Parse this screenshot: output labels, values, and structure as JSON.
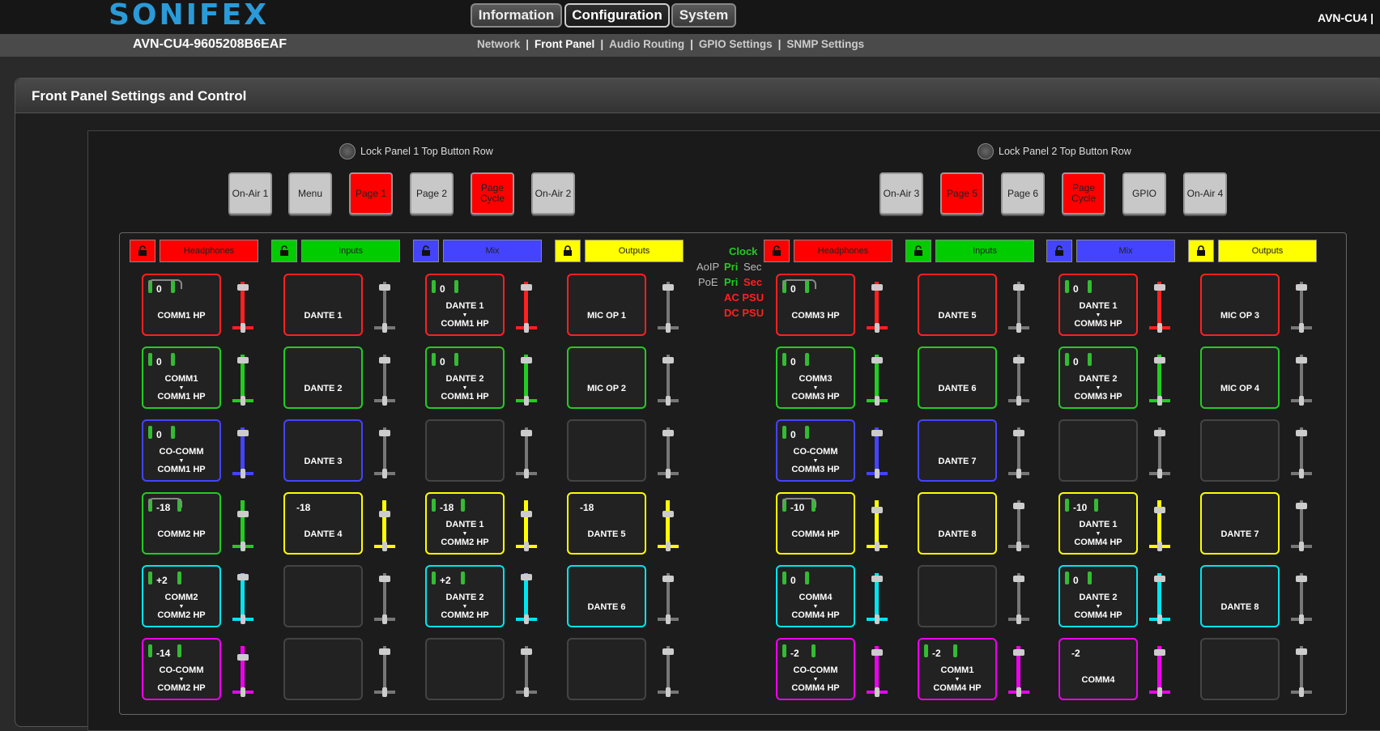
{
  "brand": {
    "name": "SONIFEX"
  },
  "nav": {
    "tabs": [
      {
        "label": "Information"
      },
      {
        "label": "Configuration"
      },
      {
        "label": "System"
      }
    ],
    "device": "AVN-CU4 |"
  },
  "subnav": {
    "device_id": "AVN-CU4-9605208B6EAF",
    "links": [
      "Network",
      "Front Panel",
      "Audio Routing",
      "GPIO Settings",
      "SNMP Settings"
    ]
  },
  "panel": {
    "title": "Front Panel Settings and Control"
  },
  "locks": {
    "panel1": "Lock Panel 1 Top Button Row",
    "panel2": "Lock Panel 2 Top Button Row"
  },
  "top_buttons": [
    {
      "label": "On-Air 1",
      "color": "grey"
    },
    {
      "label": "Menu",
      "color": "grey"
    },
    {
      "label": "Page 1",
      "color": "red"
    },
    {
      "label": "Page 2",
      "color": "grey"
    },
    {
      "label": "Page\nCycle",
      "color": "red"
    },
    {
      "label": "On-Air 2",
      "color": "grey"
    },
    {
      "label": "On-Air 3",
      "color": "grey"
    },
    {
      "label": "Page 5",
      "color": "red"
    },
    {
      "label": "Page 6",
      "color": "grey"
    },
    {
      "label": "Page\nCycle",
      "color": "red"
    },
    {
      "label": "GPIO",
      "color": "grey"
    },
    {
      "label": "On-Air 4",
      "color": "grey"
    }
  ],
  "headers": [
    {
      "label": "Headphones",
      "color": "#ff0000",
      "lock": "unlocked"
    },
    {
      "label": "Inputs",
      "color": "#00cc00",
      "lock": "unlocked"
    },
    {
      "label": "Mix",
      "color": "#4444ff",
      "lock": "unlocked"
    },
    {
      "label": "Outputs",
      "color": "#ffff00",
      "lock": "locked"
    },
    {
      "label": "Headphones",
      "color": "#ff0000",
      "lock": "unlocked"
    },
    {
      "label": "Inputs",
      "color": "#00cc00",
      "lock": "unlocked"
    },
    {
      "label": "Mix",
      "color": "#4444ff",
      "lock": "unlocked"
    },
    {
      "label": "Outputs",
      "color": "#ffff00",
      "lock": "locked"
    }
  ],
  "status": {
    "clock": "Clock",
    "aoip": "AoIP",
    "poe": "PoE",
    "pri": "Pri",
    "sec": "Sec",
    "ac_psu": "AC PSU",
    "dc_psu": "DC PSU"
  },
  "columns": [
    [
      {
        "c": "#ff2020",
        "lvl": "0",
        "l1": "",
        "l2": "COMM1 HP",
        "pills": true,
        "bracket": true,
        "fc": "#ff2020",
        "fp": 0.05
      },
      {
        "c": "#22cc22",
        "lvl": "0",
        "l1": "COMM1",
        "l2": "COMM1 HP",
        "pills": true,
        "fc": "#22cc22",
        "fp": 0.05
      },
      {
        "c": "#4444ff",
        "lvl": "0",
        "l1": "CO-COMM",
        "l2": "COMM1 HP",
        "pills": true,
        "fc": "#4444ff",
        "fp": 0.05
      },
      {
        "c": "#22cc22",
        "lvl": "-18",
        "l1": "",
        "l2": "COMM2 HP",
        "pills": true,
        "bracket": true,
        "fc": "#22cc22",
        "fp": 0.25
      },
      {
        "c": "#00e5ee",
        "lvl": "+2",
        "l1": "COMM2",
        "l2": "COMM2 HP",
        "pills": true,
        "fc": "#00e5ee",
        "fp": 0.02
      },
      {
        "c": "#ee00ee",
        "lvl": "-14",
        "l1": "CO-COMM",
        "l2": "COMM2 HP",
        "pills": true,
        "fc": "#ee00ee",
        "fp": 0.2
      }
    ],
    [
      {
        "c": "#ff2020",
        "lvl": "",
        "l1": "",
        "l2": "DANTE 1",
        "fc": "#777",
        "fp": 0.05
      },
      {
        "c": "#22cc22",
        "lvl": "",
        "l1": "",
        "l2": "DANTE 2",
        "fc": "#777",
        "fp": 0.05
      },
      {
        "c": "#4444ff",
        "lvl": "",
        "l1": "",
        "l2": "DANTE 3",
        "fc": "#777",
        "fp": 0.05
      },
      {
        "c": "#ffff00",
        "lvl": "-18",
        "l1": "",
        "l2": "DANTE 4",
        "fc": "#ffff00",
        "fp": 0.25
      },
      {
        "c": "#444444",
        "lvl": "",
        "l1": "",
        "l2": "",
        "fc": "#777",
        "fp": 0.05
      },
      {
        "c": "#444444",
        "lvl": "",
        "l1": "",
        "l2": "",
        "fc": "#777",
        "fp": 0.05
      }
    ],
    [
      {
        "c": "#ff2020",
        "lvl": "0",
        "l1": "DANTE 1",
        "l2": "COMM1 HP",
        "pills": true,
        "fc": "#ff2020",
        "fp": 0.05
      },
      {
        "c": "#22cc22",
        "lvl": "0",
        "l1": "DANTE 2",
        "l2": "COMM1 HP",
        "pills": true,
        "fc": "#22cc22",
        "fp": 0.05
      },
      {
        "c": "#444444",
        "lvl": "",
        "l1": "",
        "l2": "",
        "fc": "#777",
        "fp": 0.05
      },
      {
        "c": "#ffff00",
        "lvl": "-18",
        "l1": "DANTE 1",
        "l2": "COMM2 HP",
        "pills": true,
        "fc": "#ffff00",
        "fp": 0.25
      },
      {
        "c": "#00e5ee",
        "lvl": "+2",
        "l1": "DANTE 2",
        "l2": "COMM2 HP",
        "pills": true,
        "fc": "#00e5ee",
        "fp": 0.02
      },
      {
        "c": "#444444",
        "lvl": "",
        "l1": "",
        "l2": "",
        "fc": "#777",
        "fp": 0.05
      }
    ],
    [
      {
        "c": "#ff2020",
        "lvl": "",
        "l1": "",
        "l2": "MIC OP 1",
        "fc": "#777",
        "fp": 0.05
      },
      {
        "c": "#22cc22",
        "lvl": "",
        "l1": "",
        "l2": "MIC OP 2",
        "fc": "#777",
        "fp": 0.05
      },
      {
        "c": "#444444",
        "lvl": "",
        "l1": "",
        "l2": "",
        "fc": "#777",
        "fp": 0.05
      },
      {
        "c": "#ffff00",
        "lvl": "-18",
        "l1": "",
        "l2": "DANTE 5",
        "fc": "#ffff00",
        "fp": 0.25
      },
      {
        "c": "#00e5ee",
        "lvl": "",
        "l1": "",
        "l2": "DANTE 6",
        "fc": "#777",
        "fp": 0.05
      },
      {
        "c": "#444444",
        "lvl": "",
        "l1": "",
        "l2": "",
        "fc": "#777",
        "fp": 0.05
      }
    ],
    [
      {
        "c": "#ff2020",
        "lvl": "0",
        "l1": "",
        "l2": "COMM3 HP",
        "pills": true,
        "bracket": true,
        "fc": "#ff2020",
        "fp": 0.05
      },
      {
        "c": "#22cc22",
        "lvl": "0",
        "l1": "COMM3",
        "l2": "COMM3 HP",
        "pills": true,
        "fc": "#22cc22",
        "fp": 0.05
      },
      {
        "c": "#4444ff",
        "lvl": "0",
        "l1": "CO-COMM",
        "l2": "COMM3 HP",
        "pills": true,
        "fc": "#4444ff",
        "fp": 0.05
      },
      {
        "c": "#ffff00",
        "lvl": "-10",
        "l1": "",
        "l2": "COMM4 HP",
        "pills": true,
        "bracket": true,
        "fc": "#ffff00",
        "fp": 0.15
      },
      {
        "c": "#00e5ee",
        "lvl": "0",
        "l1": "COMM4",
        "l2": "COMM4 HP",
        "pills": true,
        "fc": "#00e5ee",
        "fp": 0.05
      },
      {
        "c": "#ee00ee",
        "lvl": "-2",
        "l1": "CO-COMM",
        "l2": "COMM4 HP",
        "pills": true,
        "fc": "#ee00ee",
        "fp": 0.07
      }
    ],
    [
      {
        "c": "#ff2020",
        "lvl": "",
        "l1": "",
        "l2": "DANTE 5",
        "fc": "#777",
        "fp": 0.05
      },
      {
        "c": "#22cc22",
        "lvl": "",
        "l1": "",
        "l2": "DANTE 6",
        "fc": "#777",
        "fp": 0.05
      },
      {
        "c": "#4444ff",
        "lvl": "",
        "l1": "",
        "l2": "DANTE 7",
        "fc": "#777",
        "fp": 0.05
      },
      {
        "c": "#ffff00",
        "lvl": "",
        "l1": "",
        "l2": "DANTE 8",
        "fc": "#777",
        "fp": 0.05
      },
      {
        "c": "#444444",
        "lvl": "",
        "l1": "",
        "l2": "",
        "fc": "#777",
        "fp": 0.05
      },
      {
        "c": "#ee00ee",
        "lvl": "-2",
        "l1": "COMM1",
        "l2": "COMM4 HP",
        "pills": true,
        "fc": "#ee00ee",
        "fp": 0.07
      }
    ],
    [
      {
        "c": "#ff2020",
        "lvl": "0",
        "l1": "DANTE 1",
        "l2": "COMM3 HP",
        "pills": true,
        "fc": "#ff2020",
        "fp": 0.05
      },
      {
        "c": "#22cc22",
        "lvl": "0",
        "l1": "DANTE 2",
        "l2": "COMM3 HP",
        "pills": true,
        "fc": "#22cc22",
        "fp": 0.05
      },
      {
        "c": "#444444",
        "lvl": "",
        "l1": "",
        "l2": "",
        "fc": "#777",
        "fp": 0.05
      },
      {
        "c": "#ffff00",
        "lvl": "-10",
        "l1": "DANTE 1",
        "l2": "COMM4 HP",
        "pills": true,
        "fc": "#ffff00",
        "fp": 0.15
      },
      {
        "c": "#00e5ee",
        "lvl": "0",
        "l1": "DANTE 2",
        "l2": "COMM4 HP",
        "pills": true,
        "fc": "#00e5ee",
        "fp": 0.05
      },
      {
        "c": "#ee00ee",
        "lvl": "-2",
        "l1": "",
        "l2": "COMM4",
        "fc": "#ee00ee",
        "fp": 0.07
      }
    ],
    [
      {
        "c": "#ff2020",
        "lvl": "",
        "l1": "",
        "l2": "MIC OP 3",
        "fc": "#777",
        "fp": 0.05
      },
      {
        "c": "#22cc22",
        "lvl": "",
        "l1": "",
        "l2": "MIC OP 4",
        "fc": "#777",
        "fp": 0.05
      },
      {
        "c": "#444444",
        "lvl": "",
        "l1": "",
        "l2": "",
        "fc": "#777",
        "fp": 0.05
      },
      {
        "c": "#ffff00",
        "lvl": "",
        "l1": "",
        "l2": "DANTE 7",
        "fc": "#777",
        "fp": 0.05
      },
      {
        "c": "#00e5ee",
        "lvl": "",
        "l1": "",
        "l2": "DANTE 8",
        "fc": "#777",
        "fp": 0.05
      },
      {
        "c": "#444444",
        "lvl": "",
        "l1": "",
        "l2": "",
        "fc": "#777",
        "fp": 0.05
      }
    ]
  ]
}
